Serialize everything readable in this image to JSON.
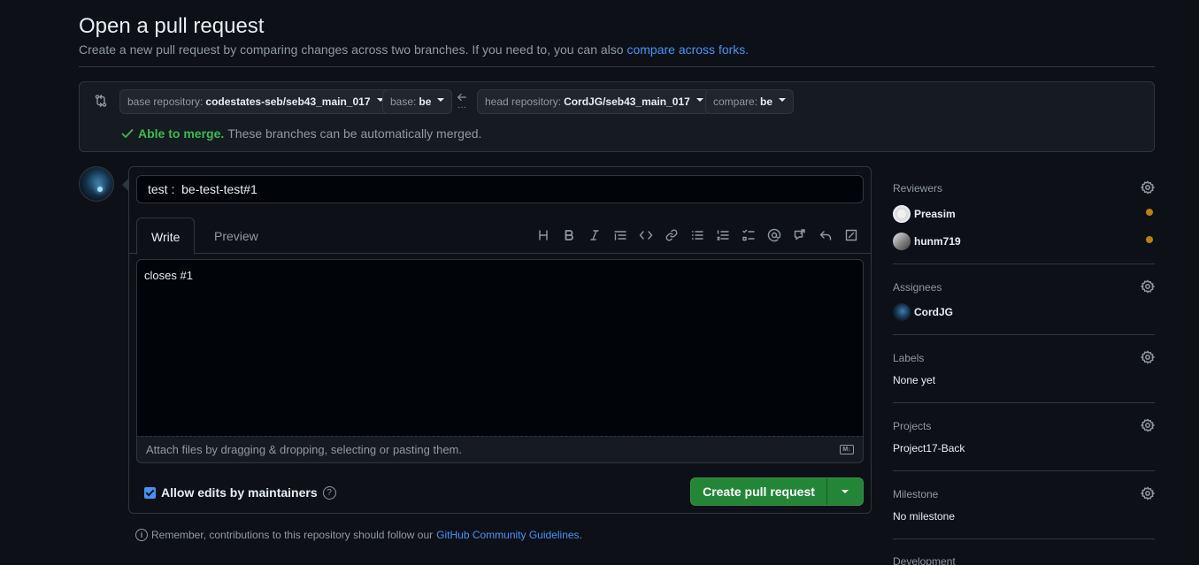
{
  "header": {
    "title": "Open a pull request",
    "subtitle": "Create a new pull request by comparing changes across two branches. If you need to, you can also",
    "subtitle_link": "compare across forks."
  },
  "compare": {
    "base_repo_label": "base repository:",
    "base_repo_value": "codestates-seb/seb43_main_017",
    "base_label": "base:",
    "base_value": "be",
    "head_repo_label": "head repository:",
    "head_repo_value": "CordJG/seb43_main_017",
    "compare_label": "compare:",
    "compare_value": "be",
    "merge_ok": "Able to merge.",
    "merge_msg": "These branches can be automatically merged."
  },
  "editor": {
    "title_value": "test :  be-test-test#1",
    "tab_write": "Write",
    "tab_preview": "Preview",
    "body_value": "closes #1",
    "attach_text": "Attach files by dragging & dropping, selecting or pasting them.",
    "allow_edits": "Allow edits by maintainers",
    "create_label": "Create pull request"
  },
  "footer": {
    "remember_text": "Remember, contributions to this repository should follow our",
    "guidelines_link": "GitHub Community Guidelines",
    "period": "."
  },
  "sidebar": {
    "reviewers": {
      "label": "Reviewers",
      "items": [
        "Preasim",
        "hunm719"
      ]
    },
    "assignees": {
      "label": "Assignees",
      "items": [
        "CordJG"
      ]
    },
    "labels": {
      "label": "Labels",
      "value": "None yet"
    },
    "projects": {
      "label": "Projects",
      "value": "Project17-Back"
    },
    "milestone": {
      "label": "Milestone",
      "value": "No milestone"
    },
    "development": {
      "label": "Development"
    }
  },
  "colors": {
    "background": "#0d1117",
    "accent_link": "#4493f8",
    "success": "#3fb950",
    "create_button": "#238636",
    "pending_dot": "#bb8009"
  }
}
